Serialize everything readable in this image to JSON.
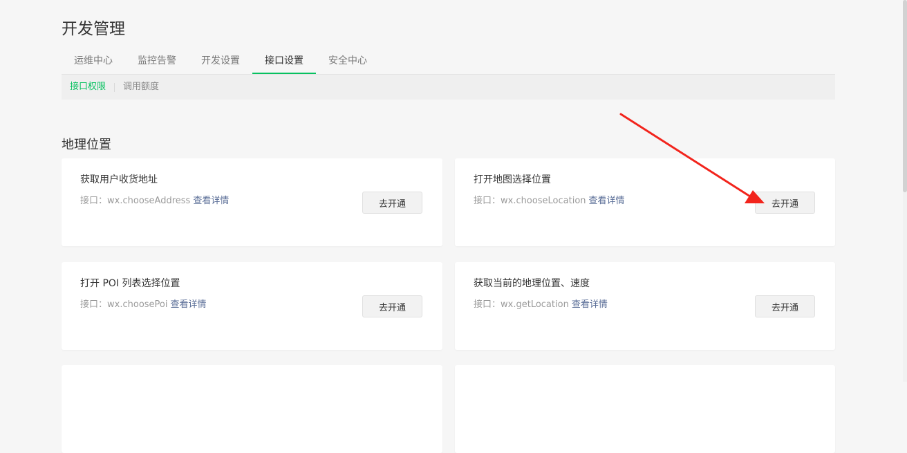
{
  "page": {
    "title": "开发管理"
  },
  "tabs": [
    {
      "label": "运维中心",
      "active": false
    },
    {
      "label": "监控告警",
      "active": false
    },
    {
      "label": "开发设置",
      "active": false
    },
    {
      "label": "接口设置",
      "active": true
    },
    {
      "label": "安全中心",
      "active": false
    }
  ],
  "subnav": [
    {
      "label": "接口权限",
      "active": true
    },
    {
      "label": "调用额度",
      "active": false
    }
  ],
  "section": {
    "title": "地理位置"
  },
  "cards": [
    {
      "name": "获取用户收货地址",
      "api_prefix": "接口：",
      "api": "wx.chooseAddress",
      "link": "查看详情",
      "button": "去开通"
    },
    {
      "name": "打开地图选择位置",
      "api_prefix": "接口：",
      "api": "wx.chooseLocation",
      "link": "查看详情",
      "button": "去开通"
    },
    {
      "name": "打开 POI 列表选择位置",
      "api_prefix": "接口：",
      "api": "wx.choosePoi",
      "link": "查看详情",
      "button": "去开通"
    },
    {
      "name": "获取当前的地理位置、速度",
      "api_prefix": "接口：",
      "api": "wx.getLocation",
      "link": "查看详情",
      "button": "去开通"
    }
  ],
  "colors": {
    "accent": "#07c160",
    "link": "#576b95",
    "annotation_arrow": "#f2241c",
    "background": "#f6f6f6"
  }
}
